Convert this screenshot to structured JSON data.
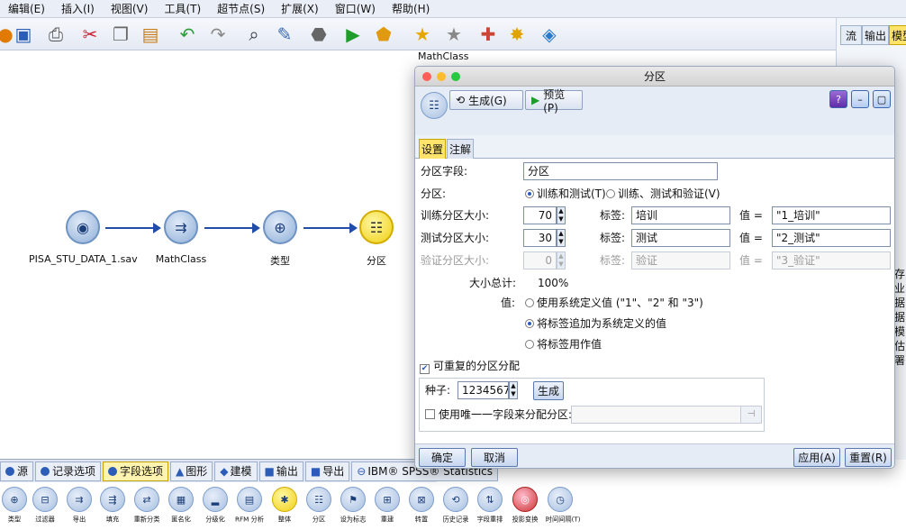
{
  "menubar": [
    "编辑(E)",
    "插入(I)",
    "视图(V)",
    "工具(T)",
    "超节点(S)",
    "扩展(X)",
    "窗口(W)",
    "帮助(H)"
  ],
  "canvas": {
    "nodes": [
      {
        "label": "PISA_STU_DATA_1.sav",
        "icon": "sav-file-icon",
        "color": "#8fb0d8"
      },
      {
        "label": "MathClass",
        "icon": "derive-icon",
        "color": "#8fb0d8"
      },
      {
        "label": "类型",
        "icon": "type-icon",
        "color": "#8fb0d8"
      },
      {
        "label": "分区",
        "icon": "partition-icon",
        "color": "#f0cf12"
      }
    ],
    "hover_label": "MathClass"
  },
  "right_strip": {
    "tabs": [
      "流",
      "输出",
      "模型"
    ],
    "chars": [
      "存",
      "业",
      "据",
      "据",
      "模",
      "估",
      "署"
    ]
  },
  "dialog": {
    "title": "分区",
    "toolbar": {
      "generate": "生成(G)",
      "preview": "预览(P)"
    },
    "tabs": [
      "设置",
      "注解"
    ],
    "partition_field_label": "分区字段:",
    "partition_field_value": "分区",
    "partition_label": "分区:",
    "partition_options": [
      "训练和测试(T)",
      "训练、测试和验证(V)"
    ],
    "train_size_label": "训练分区大小:",
    "train_size": "70",
    "test_size_label": "测试分区大小:",
    "test_size": "30",
    "validate_size_label": "验证分区大小:",
    "validate_size": "0",
    "tag_label": "标签:",
    "value_label": "值 =",
    "train_tag": "培训",
    "test_tag": "测试",
    "validate_tag": "验证",
    "train_value": "\"1_培训\"",
    "test_value": "\"2_测试\"",
    "validate_value": "\"3_验证\"",
    "total_label": "大小总计:",
    "total_value": "100%",
    "values_label": "值:",
    "values_options": [
      "使用系统定义值 (\"1\"、\"2\" 和 \"3\")",
      "将标签追加为系统定义的值",
      "将标签用作值"
    ],
    "repeatable_label": "可重复的分区分配",
    "seed_label": "种子:",
    "seed_value": "1234567",
    "seed_generate": "生成",
    "unique_field_label": "使用唯一一字段来分配分区:",
    "footer": {
      "ok": "确定",
      "cancel": "取消",
      "apply": "应用(A)",
      "reset": "重置(R)"
    }
  },
  "palette": {
    "tabs": [
      "源",
      "记录选项",
      "字段选项",
      "图形",
      "建模",
      "输出",
      "导出",
      "IBM® SPSS® Statistics"
    ],
    "active_tab": "字段选项",
    "items": [
      "类型",
      "过滤器",
      "导出",
      "填充",
      "重新分类",
      "匿名化",
      "分级化",
      "RFM 分析",
      "整体",
      "分区",
      "设为标志",
      "重建",
      "转置",
      "历史记录",
      "字段重排",
      "投影变换",
      "时间间隔(T)"
    ]
  },
  "colors": {
    "accent_blue": "#1f4da8",
    "active_tab": "#ffe36a"
  }
}
